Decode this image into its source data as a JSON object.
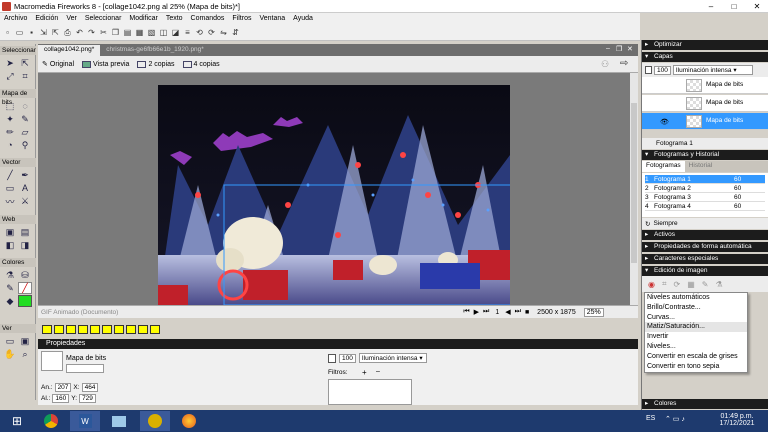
{
  "window": {
    "title": "Macromedia Fireworks 8 - [collage1042.png al  25% (Mapa de bits)*]",
    "min": "–",
    "max": "□",
    "close": "✕"
  },
  "menu": [
    "Archivo",
    "Edición",
    "Ver",
    "Seleccionar",
    "Modificar",
    "Texto",
    "Comandos",
    "Filtros",
    "Ventana",
    "Ayuda"
  ],
  "tools": {
    "sections": [
      "Seleccionar",
      "Mapa de bits",
      "Vector",
      "Web",
      "Colores",
      "Ver"
    ],
    "text_tool": "A"
  },
  "doc_tabs": [
    {
      "label": "collage1042.png*",
      "active": true
    },
    {
      "label": "christmas-ge6fb66e1b_1920.png*",
      "active": false
    }
  ],
  "view_buttons": [
    "Original",
    "Vista previa",
    "2 copias",
    "4 copias"
  ],
  "doc_status": {
    "format": "GIF Animado (Documento)",
    "frame": "1",
    "size": "2500 x 1875",
    "zoom": "25%"
  },
  "properties": {
    "header": "Propiedades",
    "object_type": "Mapa de bits",
    "w_label": "An.:",
    "w": "207",
    "x_label": "X:",
    "x": "464",
    "h_label": "Al.:",
    "h": "160",
    "y_label": "Y:",
    "y": "729",
    "opacity": "100",
    "blend": "Iluminación intensa",
    "filters_label": "Filtros:",
    "filters_add": "+"
  },
  "panels": {
    "optimizar": "Optimizar",
    "capas": "Capas",
    "capas_opacity": "100",
    "capas_blend": "Iluminación intensa",
    "layers": [
      "Mapa de bits",
      "Mapa de bits",
      "Mapa de bits"
    ],
    "layers_footer": "Fotograma 1",
    "frames_header": "Fotogramas y Historial",
    "frames_tabs": [
      "Fotogramas",
      "Historial"
    ],
    "frames": [
      {
        "num": "1",
        "name": "Fotograma 1",
        "delay": "60"
      },
      {
        "num": "2",
        "name": "Fotograma 2",
        "delay": "60"
      },
      {
        "num": "3",
        "name": "Fotograma 3",
        "delay": "60"
      },
      {
        "num": "4",
        "name": "Fotograma 4",
        "delay": "60"
      }
    ],
    "loop": "Siempre",
    "activos": "Activos",
    "propiedades_forma": "Propiedades de forma automática",
    "caracteres": "Caracteres especiales",
    "edicion": "Edición de imagen",
    "colores": "Colores"
  },
  "context_menu": [
    "Niveles automáticos",
    "Brillo/Contraste...",
    "Curvas...",
    "Matiz/Saturación...",
    "Invertir",
    "Niveles...",
    "Convertir en escala de grises",
    "Convertir en tono sepia"
  ],
  "taskbar": {
    "lang": "ES",
    "time": "01:49 p.m.",
    "date": "17/12/2021"
  },
  "colors": {
    "accent": "#3399ff",
    "panel_dark": "#1c1c1c",
    "taskbar": "#1e3a6e"
  }
}
